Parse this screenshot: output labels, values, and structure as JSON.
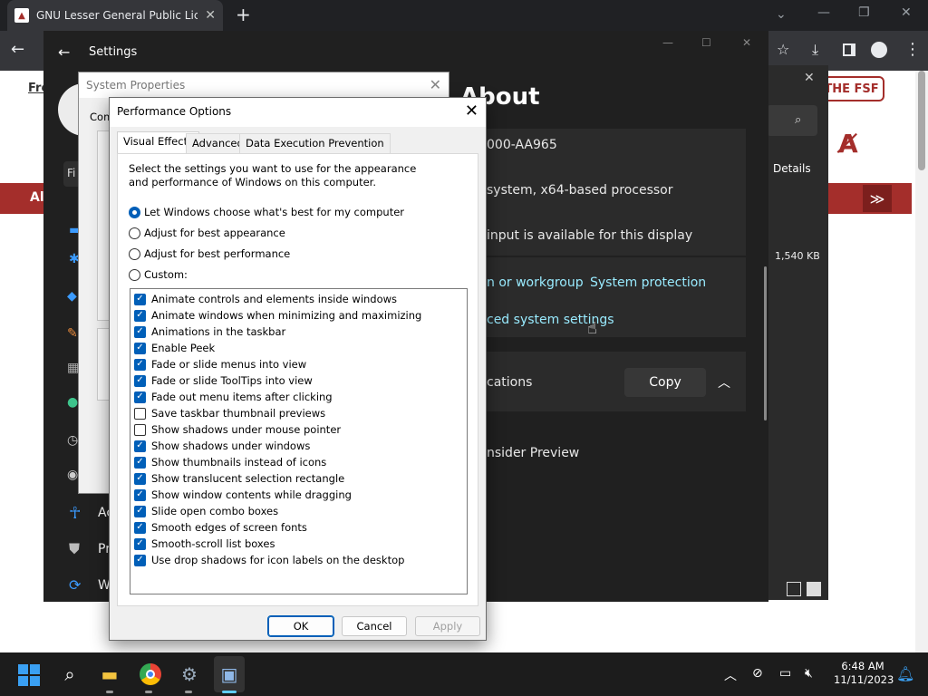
{
  "browser": {
    "tab_title": "GNU Lesser General Public Licen",
    "new_tab": "+",
    "window_controls": [
      "⌄",
      "—",
      "❐",
      "✕"
    ]
  },
  "webpage": {
    "fsf_button": "THE FSF",
    "partial_fro": "Fro",
    "partial_al": "Al",
    "redbar_arrow": "≫"
  },
  "explorer_partial": {
    "details_label": "Details",
    "size_value": "1,540 KB"
  },
  "settings": {
    "title": "Settings",
    "heading": "About",
    "product_id_partial": "000-AA965",
    "system_type_partial": "system, x64-based processor",
    "pen_touch_partial": "input is available for this display",
    "domain_link_partial": "n or workgroup",
    "system_protection_link": "System protection",
    "advanced_link_partial": "ced system settings",
    "specs_partial": "cations",
    "copy_button": "Copy",
    "insider_partial": "nsider Preview",
    "sidebar_partial": [
      "Fi",
      "Ac",
      "Pr",
      "W"
    ]
  },
  "system_properties": {
    "title": "System Properties",
    "tab_partial": "Com"
  },
  "perf": {
    "title": "Performance Options",
    "tabs": [
      "Visual Effects",
      "Advanced",
      "Data Execution Prevention"
    ],
    "description": "Select the settings you want to use for the appearance and performance of Windows on this computer.",
    "radios": [
      {
        "label": "Let Windows choose what's best for my computer",
        "selected": true
      },
      {
        "label": "Adjust for best appearance",
        "selected": false
      },
      {
        "label": "Adjust for best performance",
        "selected": false
      },
      {
        "label": "Custom:",
        "selected": false
      }
    ],
    "checkboxes": [
      {
        "label": "Animate controls and elements inside windows",
        "checked": true
      },
      {
        "label": "Animate windows when minimizing and maximizing",
        "checked": true
      },
      {
        "label": "Animations in the taskbar",
        "checked": true
      },
      {
        "label": "Enable Peek",
        "checked": true
      },
      {
        "label": "Fade or slide menus into view",
        "checked": true
      },
      {
        "label": "Fade or slide ToolTips into view",
        "checked": true
      },
      {
        "label": "Fade out menu items after clicking",
        "checked": true
      },
      {
        "label": "Save taskbar thumbnail previews",
        "checked": false
      },
      {
        "label": "Show shadows under mouse pointer",
        "checked": false
      },
      {
        "label": "Show shadows under windows",
        "checked": true
      },
      {
        "label": "Show thumbnails instead of icons",
        "checked": true
      },
      {
        "label": "Show translucent selection rectangle",
        "checked": true
      },
      {
        "label": "Show window contents while dragging",
        "checked": true
      },
      {
        "label": "Slide open combo boxes",
        "checked": true
      },
      {
        "label": "Smooth edges of screen fonts",
        "checked": true
      },
      {
        "label": "Smooth-scroll list boxes",
        "checked": true
      },
      {
        "label": "Use drop shadows for icon labels on the desktop",
        "checked": true
      }
    ],
    "ok": "OK",
    "cancel": "Cancel",
    "apply": "Apply"
  },
  "taskbar": {
    "time": "6:48 AM",
    "date": "11/11/2023"
  }
}
